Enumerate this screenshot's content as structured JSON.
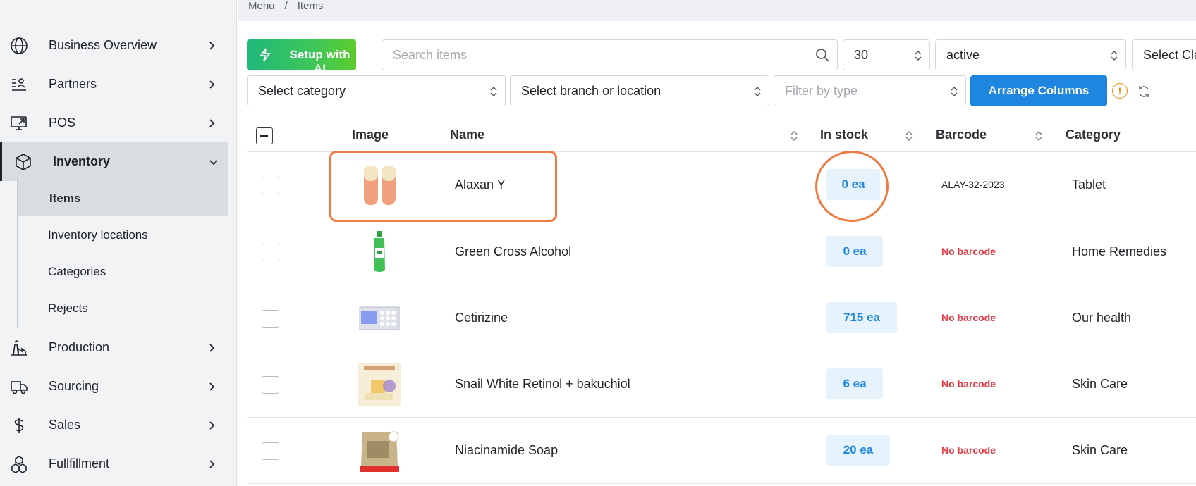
{
  "sidebar": {
    "items": [
      {
        "label": "Business Overview",
        "icon": "globe-icon"
      },
      {
        "label": "Partners",
        "icon": "partners-icon"
      },
      {
        "label": "POS",
        "icon": "monitor-icon"
      },
      {
        "label": "Inventory",
        "icon": "box-icon",
        "expanded": true
      },
      {
        "label": "Production",
        "icon": "factory-icon"
      },
      {
        "label": "Sourcing",
        "icon": "truck-icon"
      },
      {
        "label": "Sales",
        "icon": "dollar-icon"
      },
      {
        "label": "Fullfillment",
        "icon": "boxes-icon"
      }
    ],
    "inventory_sub": [
      {
        "label": "Items",
        "active": true
      },
      {
        "label": "Inventory locations"
      },
      {
        "label": "Categories"
      },
      {
        "label": "Rejects"
      }
    ]
  },
  "breadcrumb": [
    "Menu",
    "Items"
  ],
  "breadcrumb_sep": "/",
  "toolbar": {
    "setup_ai_label": "Setup with AI",
    "search_placeholder": "Search items",
    "page_size": "30",
    "status": "active",
    "class_select": "Select Cla",
    "category_select": "Select category",
    "branch_select": "Select branch or location",
    "type_placeholder": "Filter by type",
    "arrange_label": "Arrange Columns",
    "warn_glyph": "!"
  },
  "table": {
    "headers": {
      "image": "Image",
      "name": "Name",
      "in_stock": "In stock",
      "barcode": "Barcode",
      "category": "Category"
    },
    "rows": [
      {
        "name": "Alaxan Y",
        "stock": "0 ea",
        "barcode": "ALAY-32-2023",
        "category": "Tablet"
      },
      {
        "name": "Green Cross Alcohol",
        "stock": "0 ea",
        "barcode": "No barcode",
        "category": "Home Remedies"
      },
      {
        "name": "Cetirizine",
        "stock": "715 ea",
        "barcode": "No barcode",
        "category": "Our health"
      },
      {
        "name": "Snail White Retinol + bakuchiol",
        "stock": "6 ea",
        "barcode": "No barcode",
        "category": "Skin Care"
      },
      {
        "name": "Niacinamide Soap",
        "stock": "20 ea",
        "barcode": "No barcode",
        "category": "Skin Care"
      }
    ]
  },
  "colors": {
    "accent": "#1f86e0",
    "annotation": "#f07a42",
    "no_barcode": "#e53946",
    "ai_green": "#3ec65a"
  }
}
